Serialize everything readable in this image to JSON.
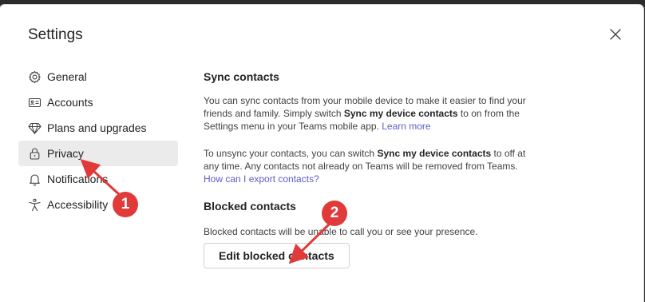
{
  "dialog": {
    "title": "Settings"
  },
  "nav": {
    "items": [
      {
        "label": "General",
        "icon": "gear-icon"
      },
      {
        "label": "Accounts",
        "icon": "id-card-icon"
      },
      {
        "label": "Plans and upgrades",
        "icon": "diamond-icon"
      },
      {
        "label": "Privacy",
        "icon": "lock-icon",
        "active": true
      },
      {
        "label": "Notifications",
        "icon": "bell-icon"
      },
      {
        "label": "Accessibility",
        "icon": "accessibility-icon"
      }
    ]
  },
  "sync": {
    "title": "Sync contacts",
    "p1_a": "You can sync contacts from your mobile device to make it easier to find your friends and family. Simply switch ",
    "p1_b": "Sync my device contacts",
    "p1_c": " to on from the Settings menu in your Teams mobile app. ",
    "p1_link": "Learn more",
    "p2_a": "To unsync your contacts, you can switch ",
    "p2_b": "Sync my device contacts",
    "p2_c": " to off at any time. Any contacts not already on Teams will be removed from Teams.",
    "p2_link": "How can I export contacts?"
  },
  "blocked": {
    "title": "Blocked contacts",
    "description": "Blocked contacts will be unable to call you or see your presence.",
    "button": "Edit blocked contacts"
  },
  "annotations": {
    "badge1": "1",
    "badge2": "2",
    "color": "#e03a3a"
  }
}
